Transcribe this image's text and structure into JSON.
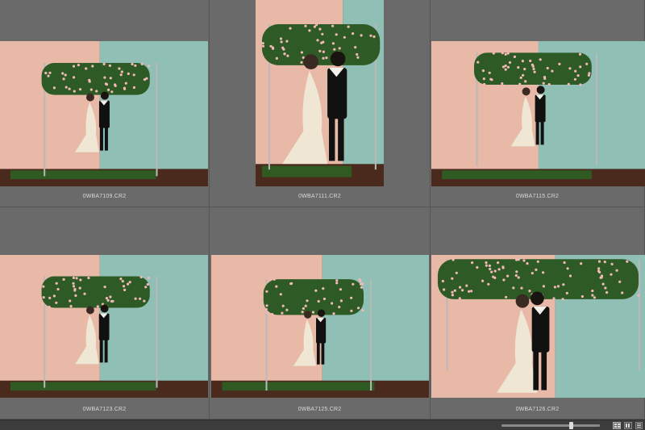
{
  "window": {
    "thumbnails": [
      {
        "filename": "0WBA7109.CR2",
        "scene": "wide-left"
      },
      {
        "filename": "0WBA7111.CR2",
        "scene": "tall"
      },
      {
        "filename": "0WBA7115.CR2",
        "scene": "wide-right"
      },
      {
        "filename": "0WBA7123.CR2",
        "scene": "wide-left"
      },
      {
        "filename": "0WBA7125.CR2",
        "scene": "wide-center"
      },
      {
        "filename": "0WBA7126.CR2",
        "scene": "close"
      }
    ]
  },
  "statusbar": {
    "zoom_level": 0.72,
    "zoom_readout": "",
    "view_modes": [
      "grid-view",
      "filmstrip-view"
    ]
  },
  "colors": {
    "panel": "#6a6a6a",
    "wall_pink": "#e7b9a6",
    "wall_teal": "#8fbfb5",
    "floor_wood": "#4a2a1c",
    "carpet": "#2f5a22",
    "foliage": "#2e5a25",
    "flower": "#f2b8b8",
    "dress": "#efe6d4",
    "suit": "#111111"
  }
}
